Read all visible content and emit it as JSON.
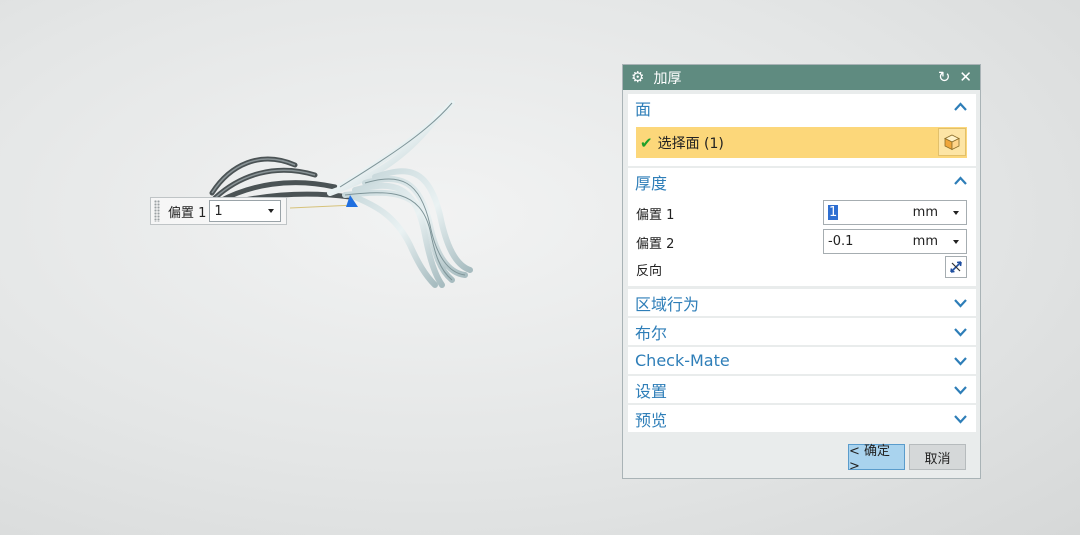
{
  "floating_widget": {
    "label": "偏置 1",
    "value": "1"
  },
  "dialog": {
    "title": "加厚",
    "face_section": {
      "header": "面",
      "select_label": "选择面 (1)"
    },
    "thickness_section": {
      "header": "厚度",
      "offset1_label": "偏置 1",
      "offset1_value": "1",
      "offset1_unit": "mm",
      "offset2_label": "偏置 2",
      "offset2_value": "-0.1",
      "offset2_unit": "mm",
      "reverse_label": "反向"
    },
    "collapsed_sections": [
      "区域行为",
      "布尔",
      "Check-Mate",
      "设置",
      "预览"
    ],
    "ok_label": "< 确定 >",
    "cancel_label": "取消"
  },
  "colors": {
    "titlebar": "#5f8b80",
    "section_header": "#2e7eb8",
    "selection_highlight": "#fcd77a",
    "ok_button": "#a9d3ee"
  }
}
